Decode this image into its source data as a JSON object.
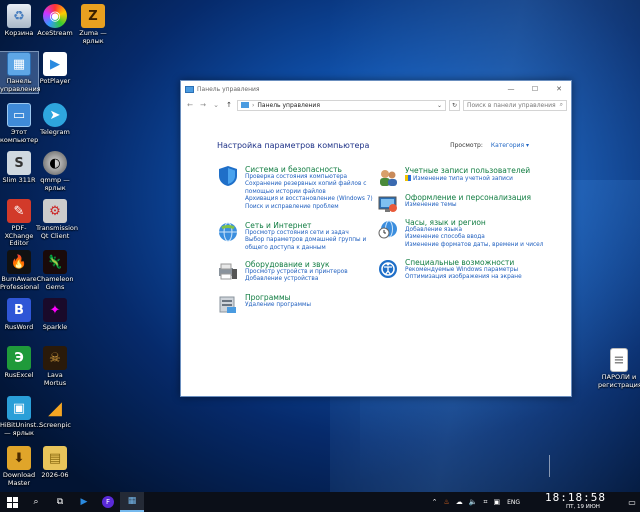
{
  "desktop": {
    "icons": [
      {
        "label": "Корзина",
        "icon": "recycle-bin-icon"
      },
      {
        "label": "AceStream",
        "icon": "acestream-icon"
      },
      {
        "label": "Zuma — ярлык",
        "icon": "zuma-icon"
      },
      {
        "label": "Панель управления",
        "icon": "control-panel-icon"
      },
      {
        "label": "PotPlayer",
        "icon": "potplayer-icon"
      },
      {
        "label": "Этот компьютер",
        "icon": "this-pc-icon"
      },
      {
        "label": "Telegram",
        "icon": "telegram-icon"
      },
      {
        "label": "Slim 311R",
        "icon": "slim-icon"
      },
      {
        "label": "qmmp — ярлык",
        "icon": "qmmp-icon"
      },
      {
        "label": "PDF-XChange Editor",
        "icon": "pdf-xchange-icon"
      },
      {
        "label": "Transmission Qt Client",
        "icon": "transmission-icon"
      },
      {
        "label": "BurnAware Professional",
        "icon": "burnaware-icon"
      },
      {
        "label": "Chameleon Gems",
        "icon": "chameleon-icon"
      },
      {
        "label": "RusWord",
        "icon": "rusword-icon"
      },
      {
        "label": "Sparkle",
        "icon": "sparkle-icon"
      },
      {
        "label": "RusExcel",
        "icon": "rusexcel-icon"
      },
      {
        "label": "Lava Mortus",
        "icon": "lava-mortus-icon"
      },
      {
        "label": "HiBitUninst... — ярлык",
        "icon": "hibit-icon"
      },
      {
        "label": "Screenpic",
        "icon": "screenpic-icon"
      },
      {
        "label": "Download Master",
        "icon": "download-master-icon"
      },
      {
        "label": "2026-06",
        "icon": "folder-icon"
      },
      {
        "label": "ПАРОЛИ и регистрация",
        "icon": "document-icon"
      }
    ]
  },
  "window": {
    "title": "Панель управления",
    "address": "Панель управления",
    "search_placeholder": "Поиск в панели управления",
    "heading": "Настройка параметров компьютера",
    "viewby_label": "Просмотр:",
    "viewby_value": "Категория",
    "categories": [
      {
        "title": "Система и безопасность",
        "icon": "security-shield-icon",
        "links": [
          "Проверка состояния компьютера",
          "Сохранение резервных копий файлов с",
          "помощью истории файлов",
          "Архивация и восстановление (Windows 7)",
          "Поиск и исправление проблем"
        ]
      },
      {
        "title": "Сеть и Интернет",
        "icon": "network-globe-icon",
        "links": [
          "Просмотр состояния сети и задач",
          "Выбор параметров домашней группы и",
          "общего доступа к данным"
        ]
      },
      {
        "title": "Оборудование и звук",
        "icon": "printer-speaker-icon",
        "links": [
          "Просмотр устройств и принтеров",
          "Добавление устройства"
        ]
      },
      {
        "title": "Программы",
        "icon": "programs-icon",
        "links": [
          "Удаление программы"
        ]
      },
      {
        "title": "Учетные записи пользователей",
        "icon": "user-accounts-icon",
        "links": [
          "Изменение типа учетной записи"
        ]
      },
      {
        "title": "Оформление и персонализация",
        "icon": "personalization-icon",
        "links": [
          "Изменение темы"
        ]
      },
      {
        "title": "Часы, язык и регион",
        "icon": "clock-globe-icon",
        "links": [
          "Добавление языка",
          "Изменение способа ввода",
          "Изменение форматов даты, времени и чисел"
        ]
      },
      {
        "title": "Специальные возможности",
        "icon": "accessibility-icon",
        "links": [
          "Рекомендуемые Windows параметры",
          "Оптимизация изображения на экране"
        ]
      }
    ]
  },
  "taskbar": {
    "language": "ENG",
    "time": "18:18:58",
    "date": "ПТ, 19 ИЮН"
  }
}
